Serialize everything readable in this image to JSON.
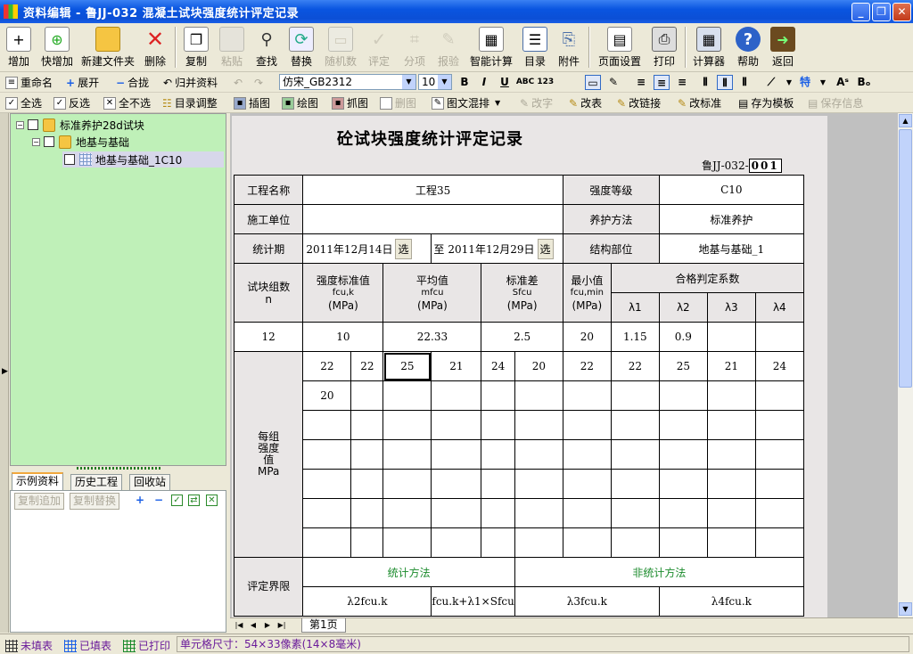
{
  "window": {
    "title": "资料编辑 - 鲁JJ-032 混凝土试块强度统计评定记录",
    "controls": [
      "_",
      "❐",
      "✕"
    ]
  },
  "toolbar": {
    "buttons": [
      {
        "label": "增加",
        "icon": "new-doc-icon",
        "enabled": true
      },
      {
        "label": "快增加",
        "icon": "quick-add-icon",
        "enabled": true
      },
      {
        "label": "新建文件夹",
        "icon": "folder-icon",
        "enabled": true
      },
      {
        "label": "删除",
        "icon": "delete-x-icon",
        "enabled": true
      },
      {
        "label": "复制",
        "icon": "copy-icon",
        "enabled": true
      },
      {
        "label": "粘贴",
        "icon": "paste-icon",
        "enabled": false
      },
      {
        "label": "查找",
        "icon": "binoculars-icon",
        "enabled": true
      },
      {
        "label": "替换",
        "icon": "replace-icon",
        "enabled": true
      },
      {
        "label": "随机数",
        "icon": "random-icon",
        "enabled": false
      },
      {
        "label": "评定",
        "icon": "check-icon",
        "enabled": false
      },
      {
        "label": "分项",
        "icon": "hierarchy-icon",
        "enabled": false
      },
      {
        "label": "报验",
        "icon": "report-icon",
        "enabled": false
      },
      {
        "label": "智能计算",
        "icon": "calc-grid-icon",
        "enabled": true
      },
      {
        "label": "目录",
        "icon": "catalog-icon",
        "enabled": true
      },
      {
        "label": "附件",
        "icon": "paperclip-icon",
        "enabled": true
      },
      {
        "label": "页面设置",
        "icon": "page-setup-icon",
        "enabled": true
      },
      {
        "label": "打印",
        "icon": "printer-icon",
        "enabled": true
      },
      {
        "label": "计算器",
        "icon": "calculator-icon",
        "enabled": true
      },
      {
        "label": "帮助",
        "icon": "help-icon",
        "enabled": true
      },
      {
        "label": "返回",
        "icon": "exit-door-icon",
        "enabled": true
      }
    ]
  },
  "treebar": {
    "rename": "重命名",
    "expand": "展开",
    "collapse": "合拢",
    "merge": "归并资料"
  },
  "selbar": {
    "select_all": "全选",
    "invert": "反选",
    "deselect_all": "全不选",
    "adjust_catalog": "目录调整"
  },
  "format": {
    "font": "仿宋_GB2312",
    "size": "10",
    "bold": "B",
    "italic": "I",
    "underline": "U",
    "abc": "ABC 123",
    "special": "特"
  },
  "insertbar": {
    "insert_image": "插图",
    "draw": "绘图",
    "capture": "抓图",
    "delete_image": "删图",
    "mixed": "图文混排",
    "modify_word": "改字",
    "modify_table": "改表",
    "modify_link": "改链接",
    "modify_standard": "改标准",
    "save_template": "存为模板",
    "save_info": "保存信息"
  },
  "tree": {
    "root": "标准养护28d试块",
    "child": "地基与基础",
    "leaf": "地基与基础_1C10"
  },
  "bottom_tabs": [
    "示例资料",
    "历史工程",
    "回收站"
  ],
  "bottom_buttons": {
    "append": "复制追加",
    "replace": "复制替换"
  },
  "document": {
    "title": "砼试块强度统计评定记录",
    "doc_no_prefix": "鲁JJ-032-",
    "doc_no": "001",
    "labels": {
      "project": "工程名称",
      "grade": "强度等级",
      "contractor": "施工单位",
      "curing": "养护方法",
      "period": "统计期",
      "to": "至",
      "pick": "选",
      "part": "结构部位",
      "groups": "试块组数",
      "groups_sym": "n",
      "std_value": "强度标准值",
      "std_sym": "fcu,k",
      "unit": "(MPa)",
      "mean": "平均值",
      "mean_sym": "mfcu",
      "stdev": "标准差",
      "stdev_sym": "Sfcu",
      "min": "最小值",
      "min_sym": "fcu,min",
      "coef": "合格判定系数",
      "lambdas": [
        "λ1",
        "λ2",
        "λ3",
        "λ4"
      ],
      "per_group": "每组强度值MPa",
      "assess": "评定界限",
      "stat_method": "统计方法",
      "nonstat_method": "非统计方法",
      "formulas": [
        "λ2fcu.k",
        "fcu.k+λ1×Sfcu",
        "λ3fcu.k",
        "λ4fcu.k"
      ]
    },
    "values": {
      "project": "工程35",
      "grade": "C10",
      "contractor": "",
      "curing": "标准养护",
      "date_from": "2011年12月14日",
      "date_to": "2011年12月29日",
      "part": "地基与基础_1",
      "groups": "12",
      "std_value": "10",
      "mean": "22.33",
      "stdev": "2.5",
      "min": "20",
      "lambda_values": [
        "1.15",
        "0.9",
        "",
        ""
      ]
    },
    "strengths": [
      [
        "22",
        "22",
        "25",
        "21",
        "24",
        "20",
        "22",
        "22",
        "25",
        "21",
        "24"
      ],
      [
        "20",
        "",
        "",
        "",
        "",
        "",
        "",
        "",
        "",
        "",
        ""
      ],
      [
        "",
        "",
        "",
        "",
        "",
        "",
        "",
        "",
        "",
        "",
        ""
      ],
      [
        "",
        "",
        "",
        "",
        "",
        "",
        "",
        "",
        "",
        "",
        ""
      ],
      [
        "",
        "",
        "",
        "",
        "",
        "",
        "",
        "",
        "",
        "",
        ""
      ],
      [
        "",
        "",
        "",
        "",
        "",
        "",
        "",
        "",
        "",
        "",
        ""
      ],
      [
        "",
        "",
        "",
        "",
        "",
        "",
        "",
        "",
        "",
        "",
        ""
      ]
    ]
  },
  "sheet_tab": "第1页",
  "status": {
    "unfilled": "未填表",
    "filled": "已填表",
    "printed": "已打印",
    "cell_size": "单元格尺寸：54×33像素(14×8毫米)"
  },
  "colors": {
    "title_blue": "#0b4fd6",
    "tree_bg": "#bff0b8",
    "status_purple": "#6a1b9a",
    "green_label": "#1b8b2c"
  }
}
